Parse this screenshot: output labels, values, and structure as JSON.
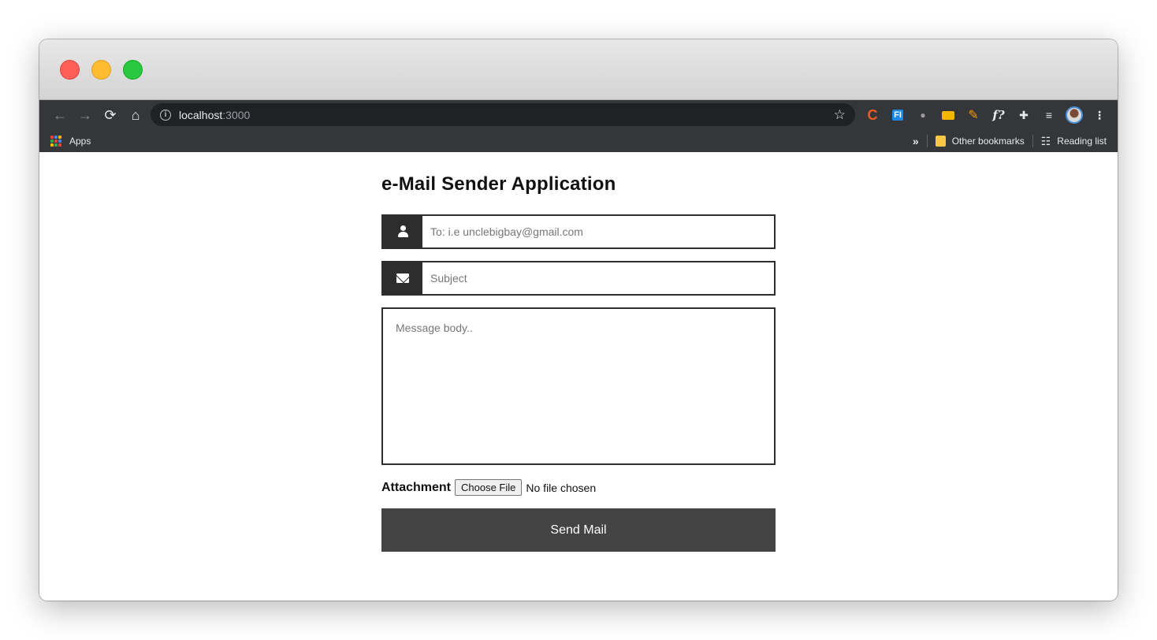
{
  "browser": {
    "address": {
      "host": "localhost",
      "port": ":3000"
    },
    "bookmarks": {
      "apps_label": "Apps",
      "overflow_label": "»",
      "other_label": "Other bookmarks",
      "reading_label": "Reading list"
    },
    "icons": {
      "back": "←",
      "forward": "→",
      "reload": "⟳",
      "home": "⌂",
      "star": "☆",
      "ext_c": "C",
      "ext_fi": "FI",
      "ext_mouse": "●",
      "ext_pencil": "✎",
      "ext_fq": "f?",
      "ext_puzzle": "✚",
      "ext_queue": "≡",
      "menu": "⋮",
      "info": "i",
      "reading": "☷"
    }
  },
  "app": {
    "title": "e-Mail Sender Application",
    "to_placeholder": "To: i.e unclebigbay@gmail.com",
    "subject_placeholder": "Subject",
    "body_placeholder": "Message body..",
    "attachment_label": "Attachment",
    "file_button_label": "Choose File",
    "file_status": "No file chosen",
    "send_label": "Send Mail"
  },
  "colors": {
    "accent": "#444444",
    "field_border": "#2d2d2d"
  }
}
